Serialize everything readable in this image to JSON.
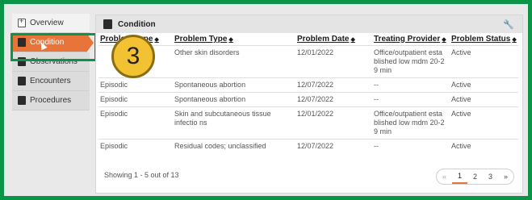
{
  "sidebar": {
    "items": [
      {
        "label": "Overview"
      },
      {
        "label": "Condition"
      },
      {
        "label": "Observations"
      },
      {
        "label": "Encounters"
      },
      {
        "label": "Procedures"
      }
    ]
  },
  "panel": {
    "title": "Condition",
    "columns": [
      "Problem Type",
      "Problem Type",
      "Problem Date",
      "Treating Provider",
      "Problem Status"
    ],
    "rows": [
      {
        "type": "",
        "problem": "Other skin disorders",
        "date": "12/01/2022",
        "provider": "Office/outpatient esta blished low mdm 20-2 9 min",
        "status": "Active"
      },
      {
        "type": "Episodic",
        "problem": "Spontaneous abortion",
        "date": "12/07/2022",
        "provider": "--",
        "status": "Active"
      },
      {
        "type": "Episodic",
        "problem": "Spontaneous abortion",
        "date": "12/07/2022",
        "provider": "--",
        "status": "Active"
      },
      {
        "type": "Episodic",
        "problem": "Skin and subcutaneous tissue infectio ns",
        "date": "12/01/2022",
        "provider": "Office/outpatient esta blished low mdm 20-2 9 min",
        "status": "Active"
      },
      {
        "type": "Episodic",
        "problem": "Residual codes; unclassified",
        "date": "12/07/2022",
        "provider": "--",
        "status": "Active"
      }
    ],
    "footer": "Showing 1 - 5 out of 13",
    "pager": [
      "«",
      "1",
      "2",
      "3",
      "»"
    ]
  },
  "annotation": {
    "step": "3"
  },
  "colors": {
    "accent": "#e8743a",
    "frame": "#0a9447",
    "badge": "#f3c233"
  }
}
